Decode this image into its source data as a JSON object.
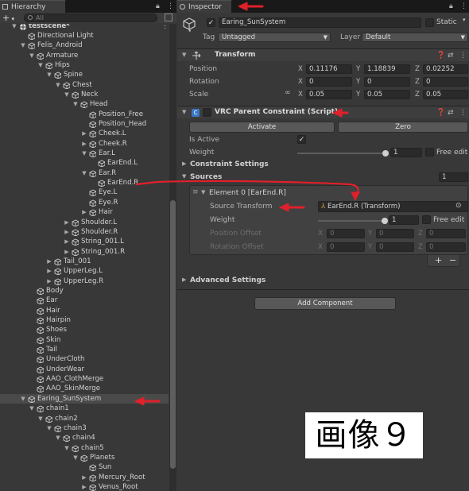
{
  "hierarchy": {
    "tab_label": "Hierarchy",
    "search_placeholder": "All",
    "add_label": "+",
    "rows": [
      {
        "label": "testscene*",
        "depth": 0,
        "fold": "down",
        "scene": true
      },
      {
        "label": "Directional Light",
        "depth": 1,
        "fold": "none"
      },
      {
        "label": "Felis_Android",
        "depth": 1,
        "fold": "down"
      },
      {
        "label": "Armature",
        "depth": 2,
        "fold": "down"
      },
      {
        "label": "Hips",
        "depth": 3,
        "fold": "down"
      },
      {
        "label": "Spine",
        "depth": 4,
        "fold": "down"
      },
      {
        "label": "Chest",
        "depth": 5,
        "fold": "down"
      },
      {
        "label": "Neck",
        "depth": 6,
        "fold": "down"
      },
      {
        "label": "Head",
        "depth": 7,
        "fold": "down"
      },
      {
        "label": "Position_Free",
        "depth": 8,
        "fold": "none"
      },
      {
        "label": "Position_Head",
        "depth": 8,
        "fold": "none"
      },
      {
        "label": "Cheek.L",
        "depth": 8,
        "fold": "right"
      },
      {
        "label": "Cheek.R",
        "depth": 8,
        "fold": "right"
      },
      {
        "label": "Ear.L",
        "depth": 8,
        "fold": "down"
      },
      {
        "label": "EarEnd.L",
        "depth": 9,
        "fold": "none"
      },
      {
        "label": "Ear.R",
        "depth": 8,
        "fold": "down"
      },
      {
        "label": "EarEnd.R",
        "depth": 9,
        "fold": "none"
      },
      {
        "label": "Eye.L",
        "depth": 8,
        "fold": "none"
      },
      {
        "label": "Eye.R",
        "depth": 8,
        "fold": "none"
      },
      {
        "label": "Hair",
        "depth": 8,
        "fold": "right"
      },
      {
        "label": "Shoulder.L",
        "depth": 6,
        "fold": "right"
      },
      {
        "label": "Shoulder.R",
        "depth": 6,
        "fold": "right"
      },
      {
        "label": "String_001.L",
        "depth": 6,
        "fold": "right"
      },
      {
        "label": "String_001.R",
        "depth": 6,
        "fold": "right"
      },
      {
        "label": "Tail_001",
        "depth": 4,
        "fold": "right"
      },
      {
        "label": "UpperLeg.L",
        "depth": 4,
        "fold": "right"
      },
      {
        "label": "UpperLeg.R",
        "depth": 4,
        "fold": "right"
      },
      {
        "label": "Body",
        "depth": 2,
        "fold": "none"
      },
      {
        "label": "Ear",
        "depth": 2,
        "fold": "none"
      },
      {
        "label": "Hair",
        "depth": 2,
        "fold": "none"
      },
      {
        "label": "Hairpin",
        "depth": 2,
        "fold": "none"
      },
      {
        "label": "Shoes",
        "depth": 2,
        "fold": "none"
      },
      {
        "label": "Skin",
        "depth": 2,
        "fold": "none"
      },
      {
        "label": "Tail",
        "depth": 2,
        "fold": "none"
      },
      {
        "label": "UnderCloth",
        "depth": 2,
        "fold": "none"
      },
      {
        "label": "UnderWear",
        "depth": 2,
        "fold": "none"
      },
      {
        "label": "AAO_ClothMerge",
        "depth": 2,
        "fold": "none"
      },
      {
        "label": "AAO_SkinMerge",
        "depth": 2,
        "fold": "none"
      },
      {
        "label": "Earing_SunSystem",
        "depth": 1,
        "fold": "down",
        "selected": true
      },
      {
        "label": "chain1",
        "depth": 2,
        "fold": "down"
      },
      {
        "label": "chain2",
        "depth": 3,
        "fold": "down"
      },
      {
        "label": "chain3",
        "depth": 4,
        "fold": "down"
      },
      {
        "label": "chain4",
        "depth": 5,
        "fold": "down"
      },
      {
        "label": "chain5",
        "depth": 6,
        "fold": "down"
      },
      {
        "label": "Planets",
        "depth": 7,
        "fold": "down"
      },
      {
        "label": "Sun",
        "depth": 8,
        "fold": "none"
      },
      {
        "label": "Mercury_Root",
        "depth": 8,
        "fold": "right"
      },
      {
        "label": "Venus_Root",
        "depth": 8,
        "fold": "right"
      }
    ]
  },
  "inspector": {
    "tab_label": "Inspector",
    "object_name": "Earing_SunSystem",
    "static_label": "Static",
    "tag_label": "Tag",
    "tag_value": "Untagged",
    "layer_label": "Layer",
    "layer_value": "Default",
    "transform": {
      "title": "Transform",
      "position_label": "Position",
      "rotation_label": "Rotation",
      "scale_label": "Scale",
      "position": {
        "x": "0.11176",
        "y": "1.18839",
        "z": "0.02252"
      },
      "rotation": {
        "x": "0",
        "y": "0",
        "z": "0"
      },
      "scale": {
        "x": "0.05",
        "y": "0.05",
        "z": "0.05"
      }
    },
    "constraint": {
      "title": "VRC Parent Constraint (Script)",
      "activate_label": "Activate",
      "zero_label": "Zero",
      "is_active_label": "Is Active",
      "weight_label": "Weight",
      "weight_value": "1",
      "free_edit_label": "Free edit",
      "constraint_settings_label": "Constraint Settings",
      "sources_label": "Sources",
      "sources_count": "1",
      "element_label": "Element 0 [EarEnd.R]",
      "source_transform_label": "Source Transform",
      "source_transform_value": "EarEnd.R (Transform)",
      "element_weight_label": "Weight",
      "element_weight_value": "1",
      "element_free_edit_label": "Free edit",
      "position_offset_label": "Position Offset",
      "rotation_offset_label": "Rotation Offset",
      "pos_offset": {
        "x": "0",
        "y": "0",
        "z": "0"
      },
      "rot_offset": {
        "x": "0",
        "y": "0",
        "z": "0"
      },
      "add_label": "+",
      "remove_label": "−",
      "advanced_label": "Advanced Settings"
    },
    "add_component_label": "Add Component"
  },
  "annotation": {
    "caption": "画像９",
    "arrow_color": "#e0202a"
  }
}
